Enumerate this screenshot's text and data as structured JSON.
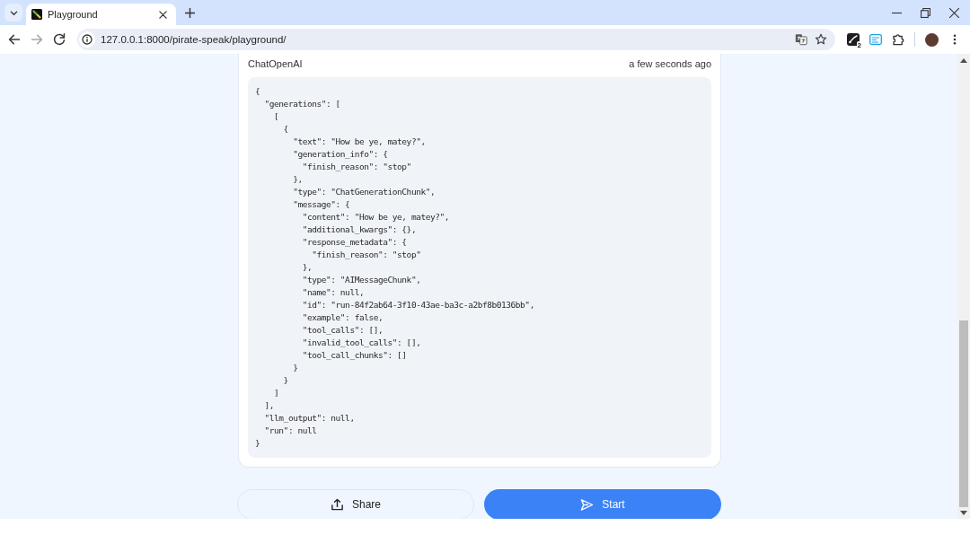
{
  "browser": {
    "tabs": [
      {
        "title": "Playground",
        "selected": true
      }
    ],
    "nav_buttons": [
      {
        "kind": "back",
        "disabled": false
      },
      {
        "kind": "forward",
        "disabled": true
      },
      {
        "kind": "reload",
        "disabled": false
      }
    ],
    "address": "127.0.0.1:8000/pirate-speak/playground/",
    "extensions": [
      {
        "kind": "pen",
        "badge": "2"
      },
      {
        "kind": "reader"
      },
      {
        "kind": "puzzle"
      }
    ]
  },
  "run_card": {
    "source": "ChatOpenAI",
    "time": "a few seconds ago",
    "output": "{\n  \"generations\": [\n    [\n      {\n        \"text\": \"How be ye, matey?\",\n        \"generation_info\": {\n          \"finish_reason\": \"stop\"\n        },\n        \"type\": \"ChatGenerationChunk\",\n        \"message\": {\n          \"content\": \"How be ye, matey?\",\n          \"additional_kwargs\": {},\n          \"response_metadata\": {\n            \"finish_reason\": \"stop\"\n          },\n          \"type\": \"AIMessageChunk\",\n          \"name\": null,\n          \"id\": \"run-84f2ab64-3f10-43ae-ba3c-a2bf8b0136bb\",\n          \"example\": false,\n          \"tool_calls\": [],\n          \"invalid_tool_calls\": [],\n          \"tool_call_chunks\": []\n        }\n      }\n    ]\n  ],\n  \"llm_output\": null,\n  \"run\": null\n}"
  },
  "actions": [
    {
      "kind": "share",
      "label": "Share"
    },
    {
      "kind": "start",
      "label": "Start"
    }
  ]
}
